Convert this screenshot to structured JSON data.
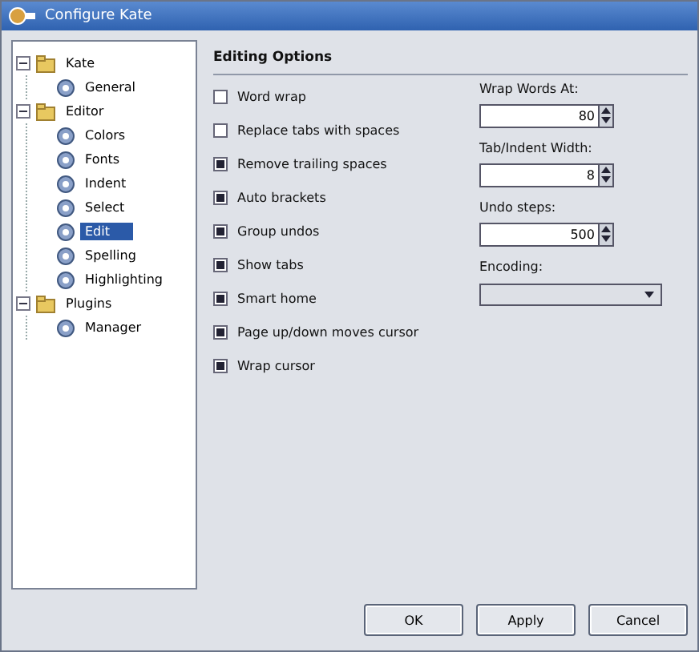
{
  "window": {
    "title": "Configure Kate"
  },
  "tree": [
    {
      "label": "Kate",
      "expanded": true,
      "selected": false,
      "children": [
        {
          "label": "General",
          "selected": false
        }
      ]
    },
    {
      "label": "Editor",
      "expanded": true,
      "selected": false,
      "children": [
        {
          "label": "Colors",
          "selected": false
        },
        {
          "label": "Fonts",
          "selected": false
        },
        {
          "label": "Indent",
          "selected": false
        },
        {
          "label": "Select",
          "selected": false
        },
        {
          "label": "Edit",
          "selected": true
        },
        {
          "label": "Spelling",
          "selected": false
        },
        {
          "label": "Highlighting",
          "selected": false
        }
      ]
    },
    {
      "label": "Plugins",
      "expanded": true,
      "selected": false,
      "children": [
        {
          "label": "Manager",
          "selected": false
        }
      ]
    }
  ],
  "page": {
    "heading": "Editing Options",
    "options": [
      {
        "label": "Word wrap",
        "checked": false
      },
      {
        "label": "Replace tabs with spaces",
        "checked": false
      },
      {
        "label": "Remove trailing spaces",
        "checked": true
      },
      {
        "label": "Auto brackets",
        "checked": true
      },
      {
        "label": "Group undos",
        "checked": true
      },
      {
        "label": "Show tabs",
        "checked": true
      },
      {
        "label": "Smart home",
        "checked": true
      },
      {
        "label": "Page up/down moves cursor",
        "checked": true
      },
      {
        "label": "Wrap cursor",
        "checked": true
      }
    ],
    "fields": [
      {
        "kind": "spin",
        "label": "Wrap Words At:",
        "value": "80"
      },
      {
        "kind": "spin",
        "label": "Tab/Indent Width:",
        "value": "8"
      },
      {
        "kind": "spin",
        "label": "Undo steps:",
        "value": "500"
      },
      {
        "kind": "combo",
        "label": "Encoding:"
      }
    ]
  },
  "buttons": [
    "OK",
    "Apply",
    "Cancel"
  ]
}
